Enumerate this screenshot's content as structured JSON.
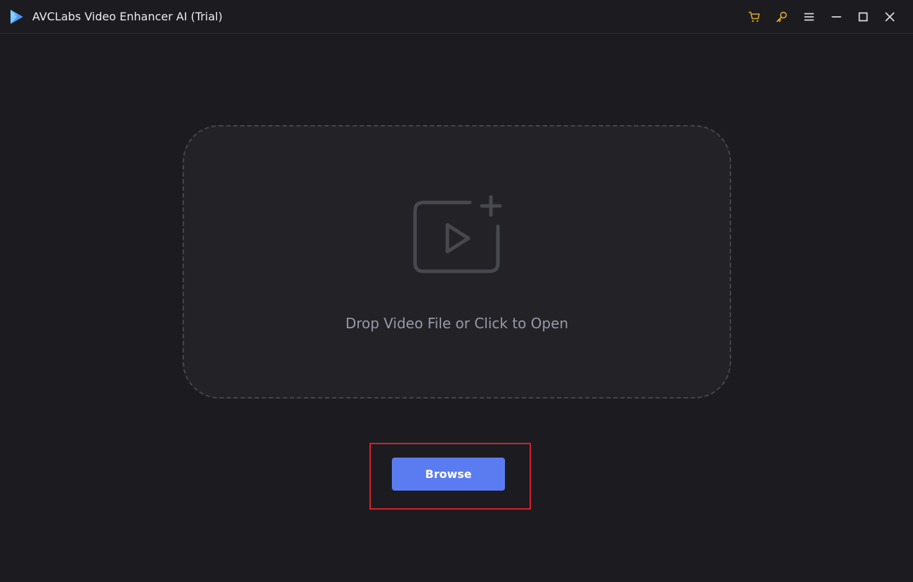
{
  "window": {
    "title": "AVCLabs Video Enhancer AI (Trial)"
  },
  "titlebar_icons": {
    "logo": "play-logo-icon",
    "cart": "cart-icon",
    "key": "key-icon",
    "menu": "menu-icon",
    "minimize": "minimize-icon",
    "maximize": "maximize-icon",
    "close": "close-icon"
  },
  "drop_zone": {
    "icon": "add-video-icon",
    "text": "Drop Video File or Click to Open"
  },
  "actions": {
    "browse_label": "Browse"
  },
  "colors": {
    "background": "#1c1c20",
    "drop_zone_bg": "#222227",
    "accent_button": "#5b7cf0",
    "highlight_border": "#d81f2a",
    "icon_gold": "#e0a62c"
  }
}
